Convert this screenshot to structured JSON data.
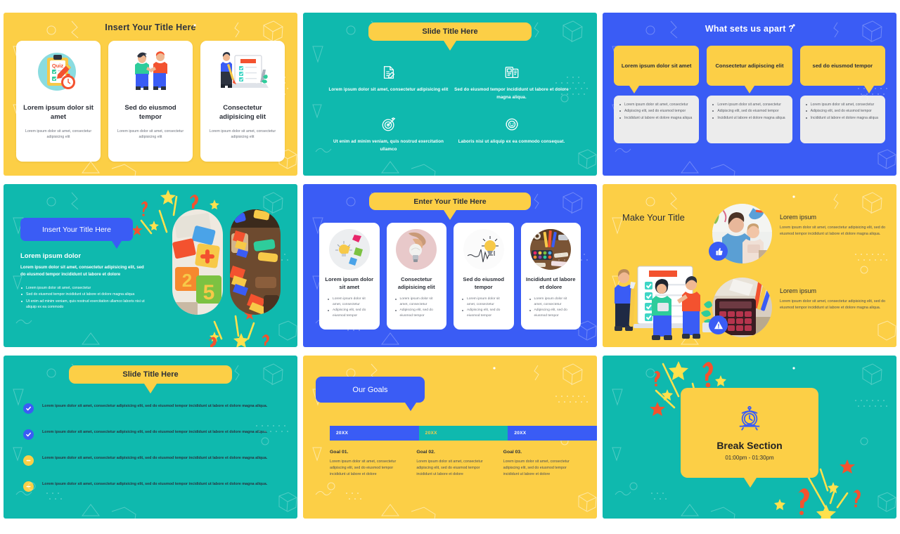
{
  "deck": {
    "colors": {
      "yellow": "#FCCF46",
      "teal": "#0FB9AE",
      "blue": "#3A5CF5",
      "card_white": "#FFFFFF",
      "gray_panel": "#ECECEC",
      "red_accent": "#F3522F",
      "dark_text": "#2B2F38"
    }
  },
  "slides": [
    {
      "id": "slide-1",
      "background": "yellow",
      "title": "Insert Your Title Here",
      "cards": [
        {
          "icon": "quiz-clipboard-stopwatch-illustration",
          "title": "Lorem ipsum dolor sit amet",
          "body": "Lorem ipsum dolor sit amet, consectetur adipisicing elit"
        },
        {
          "icon": "two-people-talking-illustration",
          "title": "Sed do eiusmod tempor",
          "body": "Lorem ipsum dolor sit amet, consectetur adipisicing elit"
        },
        {
          "icon": "person-laptop-checklist-illustration",
          "title": "Consectetur adipisicing elit",
          "body": "Lorem ipsum dolor sit amet, consectetur adipisicing elit"
        }
      ]
    },
    {
      "id": "slide-2",
      "background": "teal",
      "title": "Slide Title Here",
      "items": [
        {
          "icon": "document-edit-icon",
          "text": "Lorem ipsum dolor sit amet, consectetur adipisicing elit"
        },
        {
          "icon": "devices-screens-icon",
          "text": "Sed do eiusmod tempor incididunt ut labore et dolore magna aliqua."
        },
        {
          "icon": "target-dart-icon",
          "text": "Ut enim ad minim veniam, quis nostrud exercitation ullamco"
        },
        {
          "icon": "headset-support-icon",
          "text": "Laboris nisi ut aliquip ex ea commodo consequat."
        }
      ]
    },
    {
      "id": "slide-3",
      "background": "blue",
      "title": "What sets us apart ?",
      "columns": [
        {
          "head": "Lorem ipsum dolor sit amet",
          "bullets": [
            "Lorem ipsum dolor sit amet, consectetur",
            "Adipiscing elit, sed do eiusmod tempor",
            "Incididunt ut labore et dolore magna aliqua"
          ]
        },
        {
          "head": "Consectetur adipiscing elit",
          "bullets": [
            "Lorem ipsum dolor sit amet, consectetur",
            "Adipiscing elit, sed do eiusmod tempor",
            "Incididunt ut labore et dolore magna aliqua"
          ]
        },
        {
          "head": "sed do eiusmod tempor",
          "bullets": [
            "Lorem ipsum dolor sit amet, consectetur",
            "Adipiscing elit, sed do eiusmod tempor",
            "Incididunt ut labore et dolore magna aliqua"
          ]
        }
      ]
    },
    {
      "id": "slide-4",
      "background": "teal",
      "title": "Insert Your Title Here",
      "subtitle": "Lorem ipsum dolor",
      "lead": "Lorem ipsum dolor sit amet, consectetur adipisicing elit, sed do eiusmod tempor incididunt ut labore et dolore",
      "bullets": [
        "Lorem ipsum dolor sit amet, consectetur",
        "Sed do eiusmod tempor incididunt ut labore et dolore magna aliqua",
        "Ut enim ad minim veniam, quis nostrud exercitation ullamco laboris nisi ut aliquip ex ea commodo"
      ],
      "photos": [
        "foam-number-blocks-photo",
        "colorful-craft-materials-photo"
      ]
    },
    {
      "id": "slide-5",
      "background": "blue",
      "title": "Enter Your Title Here",
      "cards": [
        {
          "image": "crumpled-paper-lightbulb-photo",
          "title": "Lorem ipsum dolor sit amet",
          "bullets": [
            "Lorem ipsum dolor sit amet, consectetur",
            "Adipiscing elit, sed do eiusmod tempor"
          ]
        },
        {
          "image": "hand-holding-lightbulb-photo",
          "title": "Consectetur adipisicing elit",
          "bullets": [
            "Lorem ipsum dolor sit amet, consectetur",
            "Adipiscing elit, sed do eiusmod tempor"
          ]
        },
        {
          "image": "lightbulb-sketch-photo",
          "title": "Sed do eiusmod tempor",
          "bullets": [
            "Lorem ipsum dolor sit amet, consectetur",
            "Adipiscing elit, sed do eiusmod tempor"
          ]
        },
        {
          "image": "art-supplies-desk-photo",
          "title": "Incididunt ut labore et dolore",
          "bullets": [
            "Lorem ipsum dolor sit amet, consectetur",
            "Adipiscing elit, sed do eiusmod tempor"
          ]
        }
      ]
    },
    {
      "id": "slide-6",
      "background": "yellow",
      "title": "Make Your Title",
      "illustration": "people-checklist-board-illustration",
      "rows": [
        {
          "image": "mother-and-child-photo",
          "badge": "thumbs-up-icon",
          "heading": "Lorem ipsum",
          "body": "Lorem ipsum dolor sit amet, consectetur adipisicing elit, sed do eiusmod tempor incididunt ut labore et dolore magna aliqua."
        },
        {
          "image": "calculator-desk-photo",
          "badge": "warning-icon",
          "heading": "Lorem ipsum",
          "body": "Lorem ipsum dolor sit amet, consectetur adipisicing elit, sed do eiusmod tempor incididunt ut labore et dolore magna aliqua."
        }
      ]
    },
    {
      "id": "slide-7",
      "background": "teal",
      "title": "Slide Title Here",
      "items": [
        {
          "marker": "check-circle-icon",
          "marker_color": "#3A5CF5",
          "text": "Lorem ipsum dolor sit amet, consectetur adipisicing elit, sed do eiusmod tempor incididunt ut labore et dolore magna aliqua."
        },
        {
          "marker": "check-circle-icon",
          "marker_color": "#3A5CF5",
          "text": "Lorem ipsum dolor sit amet, consectetur adipisicing elit, sed do eiusmod tempor incididunt ut labore et dolore magna aliqua."
        },
        {
          "marker": "minus-circle-icon",
          "marker_color": "#FCCF46",
          "text": "Lorem ipsum dolor sit amet, consectetur adipisicing elit, sed do eiusmod tempor incididunt ut labore et dolore magna aliqua."
        },
        {
          "marker": "minus-circle-icon",
          "marker_color": "#FCCF46",
          "text": "Lorem ipsum dolor sit amet, consectetur adipisicing elit, sed do eiusmod tempor incididunt ut labore et dolore magna aliqua."
        }
      ]
    },
    {
      "id": "slide-8",
      "background": "yellow",
      "title": "Our Goals",
      "timeline": [
        {
          "label": "20XX",
          "color": "blue"
        },
        {
          "label": "20XX",
          "color": "teal"
        },
        {
          "label": "20XX",
          "color": "blue"
        }
      ],
      "goals": [
        {
          "heading": "Goal 01.",
          "body": "Lorem ipsum dolor sit amet, consectetur adipiscing elit, sed do eiusmod tempor incididunt ut labore et dolore"
        },
        {
          "heading": "Goal 02.",
          "body": "Lorem ipsum dolor sit amet, consectetur adipiscing elit, sed do eiusmod tempor incididunt ut labore et dolore"
        },
        {
          "heading": "Goal 03.",
          "body": "Lorem ipsum dolor sit amet, consectetur adipiscing elit, sed do eiusmod tempor incididunt ut labore et dolore"
        }
      ]
    },
    {
      "id": "slide-9",
      "background": "teal",
      "icon": "alarm-clock-icon",
      "title": "Break Section",
      "time": "01:00pm - 01:30pm"
    }
  ]
}
